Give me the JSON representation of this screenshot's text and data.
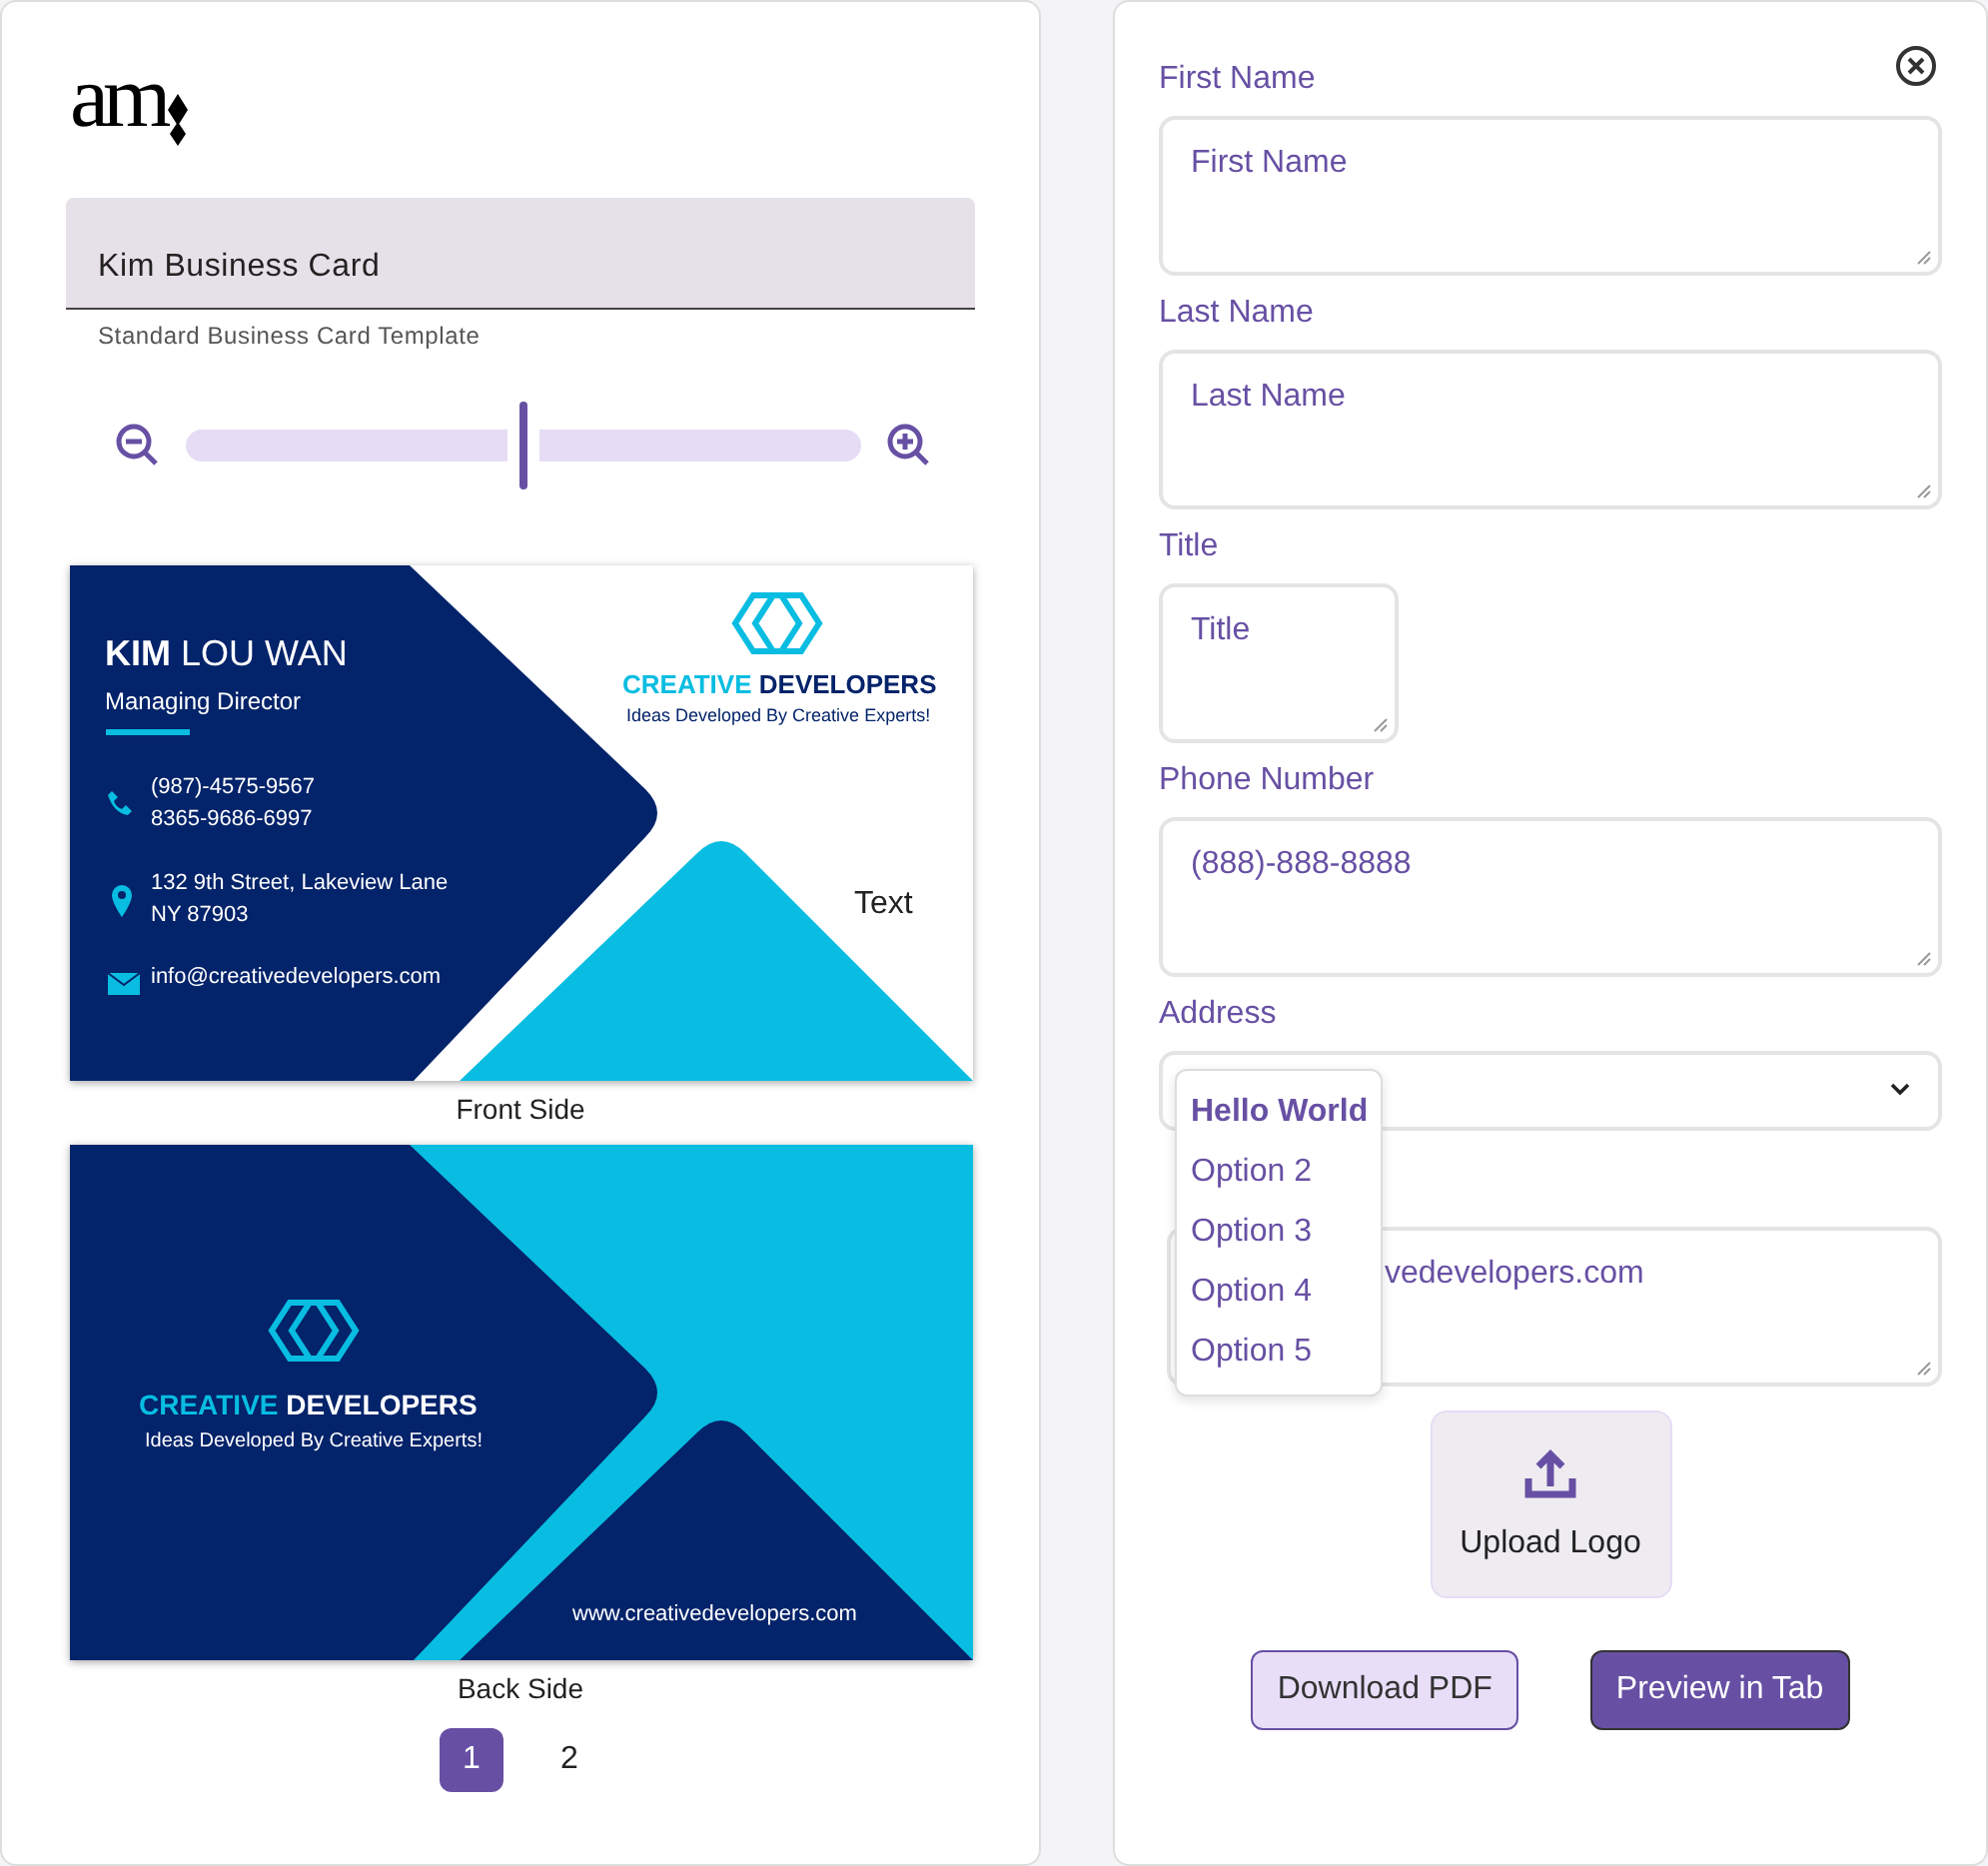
{
  "logo": {
    "text": "am"
  },
  "template": {
    "name": "Kim Business Card",
    "helper": "Standard Business Card Template"
  },
  "zoom": {
    "level": 0.5
  },
  "front": {
    "name_first": "KIM",
    "name_rest": "LOU WAN",
    "role": "Managing Director",
    "phones": [
      "(987)-4575-9567",
      "8365-9686-6997"
    ],
    "address": [
      "132 9th Street, Lakeview Lane",
      "NY 87903"
    ],
    "email": "info@creativedevelopers.com",
    "company_first": "CREATIVE",
    "company_rest": "DEVELOPERS",
    "tagline": "Ideas Developed By Creative Experts!",
    "extra_text": "Text",
    "caption": "Front Side"
  },
  "back": {
    "company_first": "CREATIVE",
    "company_rest": "DEVELOPERS",
    "tagline": "Ideas Developed By Creative Experts!",
    "website": "www.creativedevelopers.com",
    "caption": "Back Side"
  },
  "pagination": [
    {
      "label": "1",
      "selected": true
    },
    {
      "label": "2",
      "selected": false
    }
  ],
  "form": {
    "fields": [
      {
        "kind": "textarea",
        "label": "First Name",
        "placeholder": "First Name"
      },
      {
        "kind": "textarea",
        "label": "Last Name",
        "placeholder": "Last Name"
      },
      {
        "kind": "short",
        "label": "Title",
        "placeholder": "Title"
      },
      {
        "kind": "textarea",
        "label": "Phone Number",
        "placeholder": "(888)-888-8888"
      },
      {
        "kind": "select",
        "label": "Address",
        "options": [
          {
            "label": "Hello World",
            "selected": true
          },
          {
            "label": "Option 2",
            "selected": false
          },
          {
            "label": "Option 3",
            "selected": false
          },
          {
            "label": "Option 4",
            "selected": false
          },
          {
            "label": "Option 5",
            "selected": false
          }
        ]
      },
      {
        "kind": "covered",
        "value": "vedevelopers.com"
      }
    ],
    "upload": "Upload Logo",
    "buttons": [
      {
        "label": "Download PDF",
        "kind": "secondary"
      },
      {
        "label": "Preview in Tab",
        "kind": "primary"
      }
    ]
  }
}
